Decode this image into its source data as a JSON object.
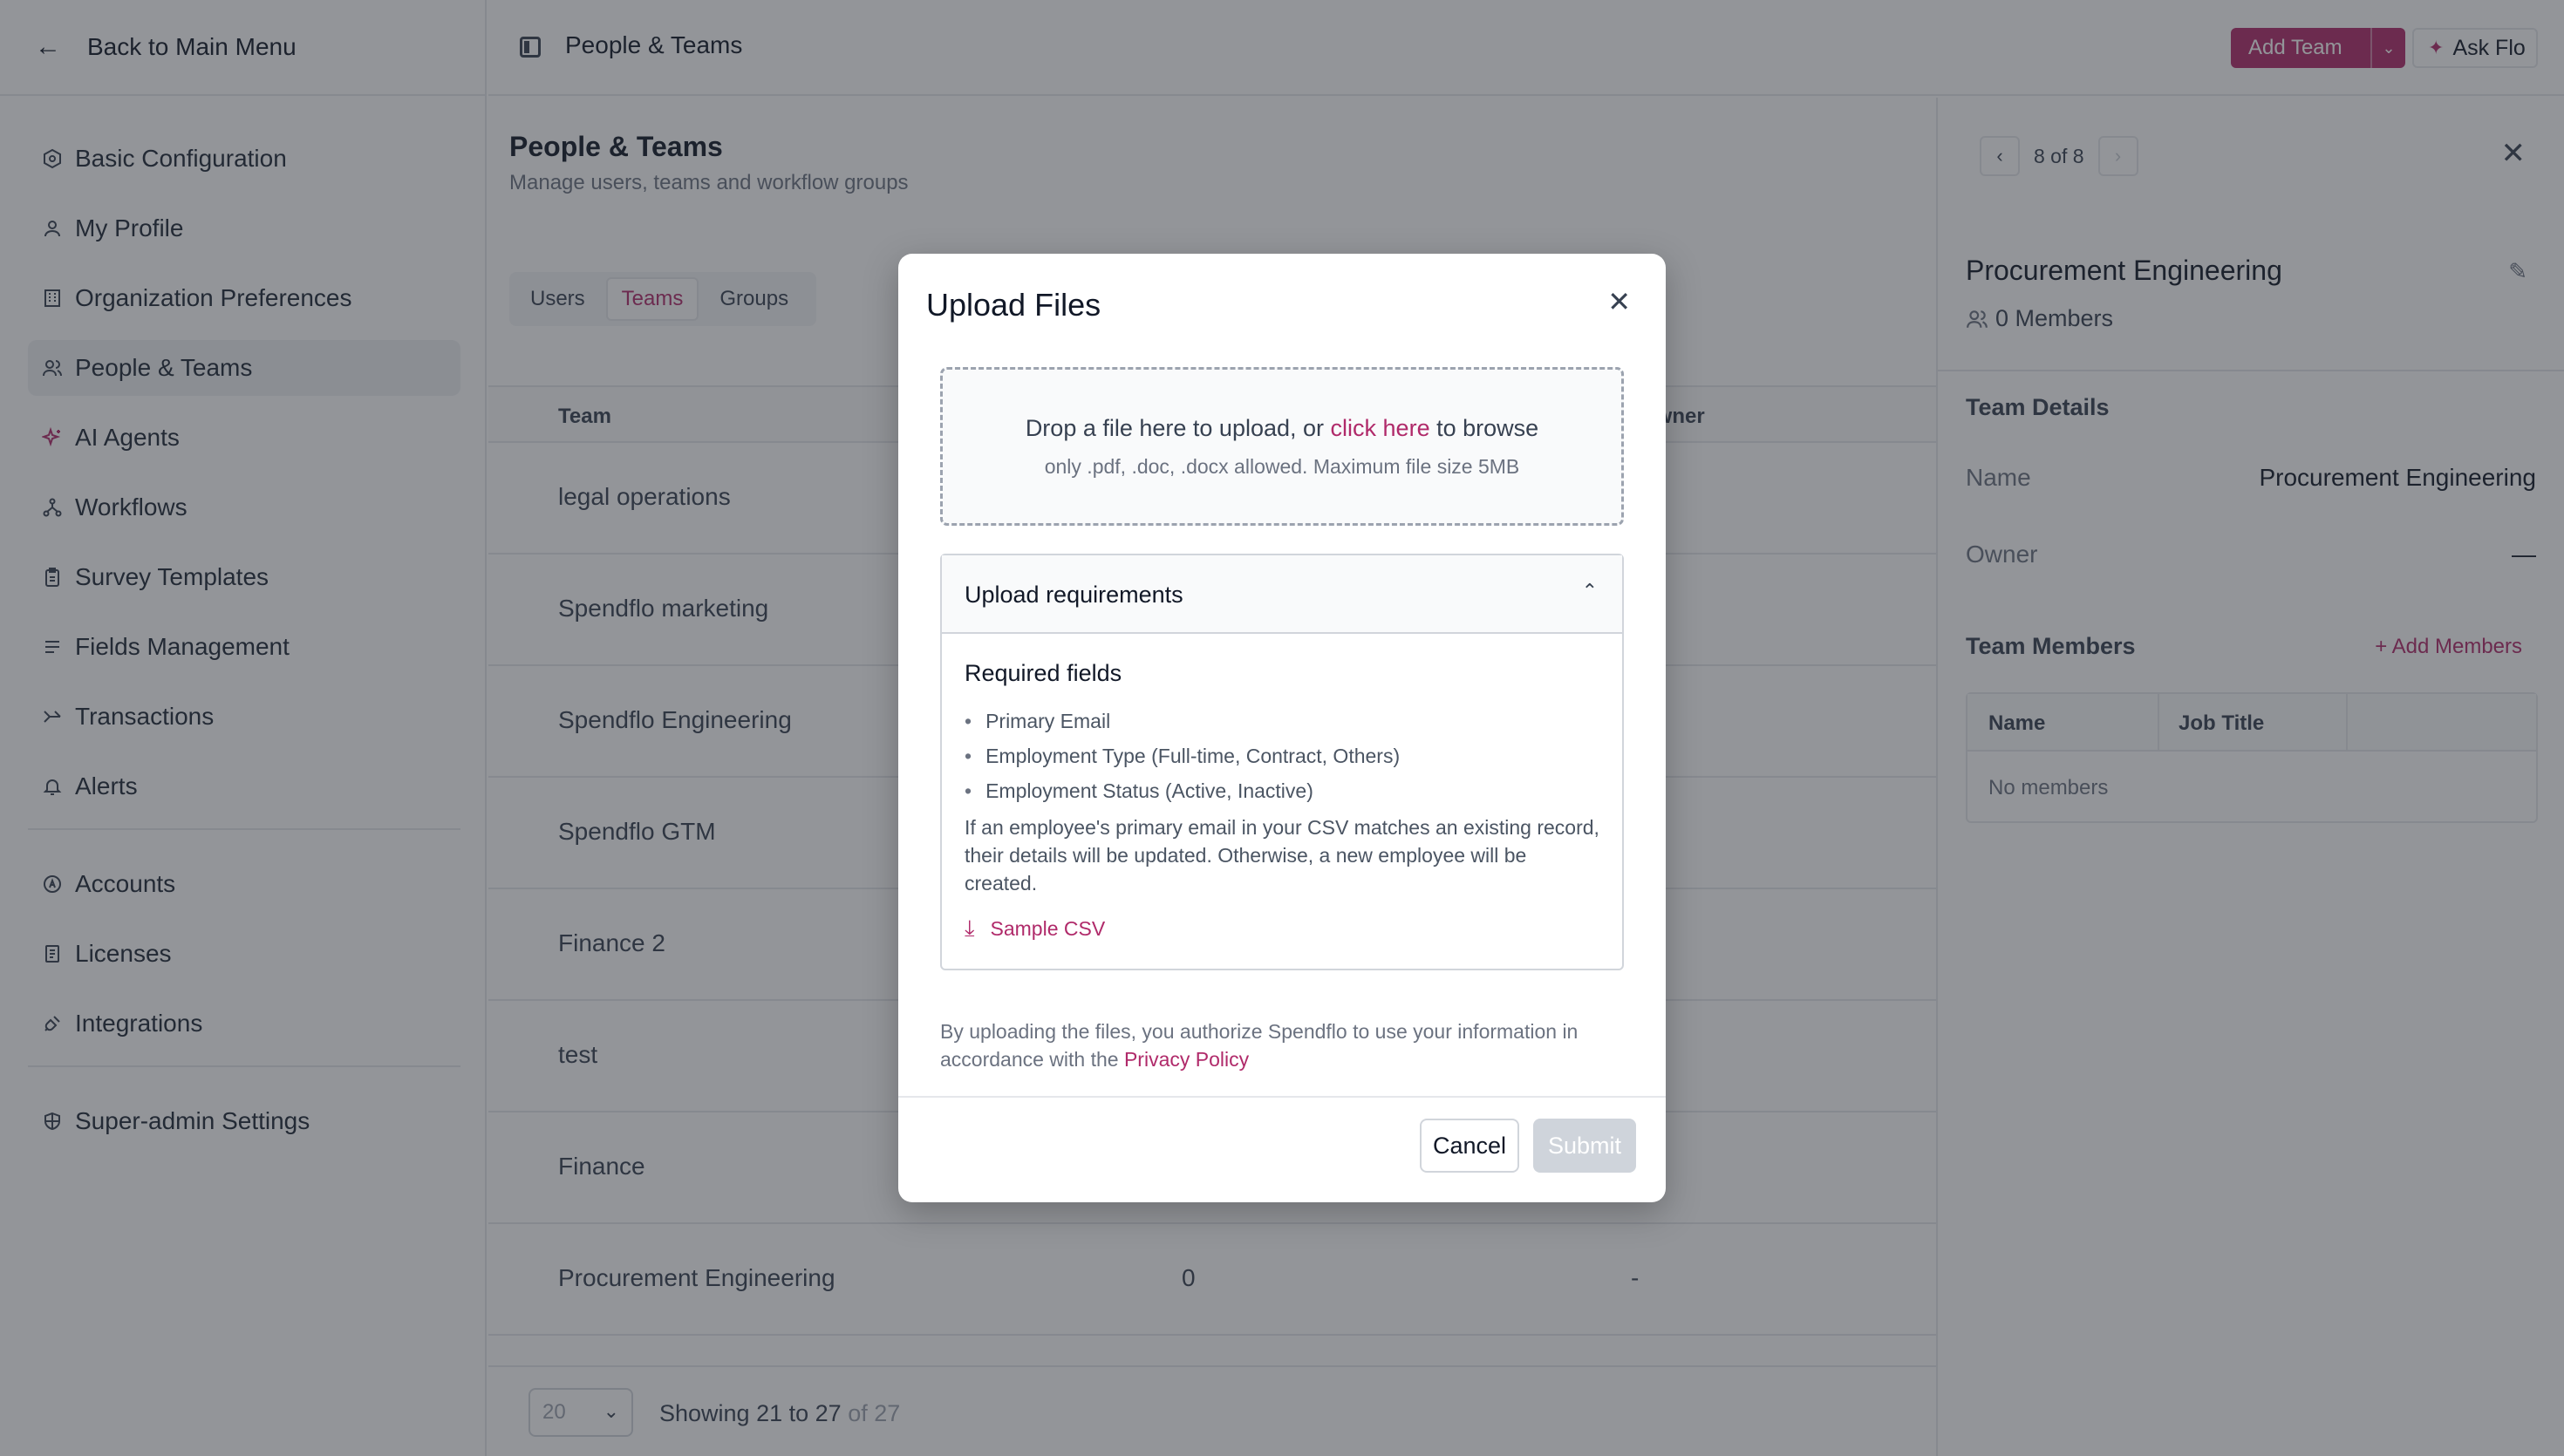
{
  "sidebar": {
    "back_label": "Back to Main Menu",
    "items": [
      {
        "label": "Basic Configuration",
        "icon": "settings-icon"
      },
      {
        "label": "My Profile",
        "icon": "user-icon"
      },
      {
        "label": "Organization Preferences",
        "icon": "building-icon"
      },
      {
        "label": "People & Teams",
        "icon": "users-icon",
        "active": true
      },
      {
        "label": "AI Agents",
        "icon": "sparkle-icon"
      },
      {
        "label": "Workflows",
        "icon": "workflow-icon"
      },
      {
        "label": "Survey Templates",
        "icon": "clipboard-icon"
      },
      {
        "label": "Fields Management",
        "icon": "list-icon"
      },
      {
        "label": "Transactions",
        "icon": "transaction-icon"
      },
      {
        "label": "Alerts",
        "icon": "bell-icon"
      }
    ],
    "items2": [
      {
        "label": "Accounts",
        "icon": "accounts-icon"
      },
      {
        "label": "Licenses",
        "icon": "license-icon"
      },
      {
        "label": "Integrations",
        "icon": "plug-icon"
      }
    ],
    "items3": [
      {
        "label": "Super-admin Settings",
        "icon": "shield-icon"
      }
    ]
  },
  "topbar": {
    "title": "People & Teams",
    "add_team_label": "Add Team",
    "ask_flo_label": "Ask Flo"
  },
  "main": {
    "title": "People & Teams",
    "subtitle": "Manage users, teams and workflow groups",
    "tabs": [
      {
        "label": "Users"
      },
      {
        "label": "Teams",
        "active": true
      },
      {
        "label": "Groups"
      }
    ],
    "columns": {
      "team": "Team",
      "owner_partial": "m Owner"
    },
    "rows": [
      {
        "team": "legal operations",
        "members": "",
        "owner": ""
      },
      {
        "team": "Spendflo marketing",
        "members": "",
        "owner": ""
      },
      {
        "team": "Spendflo Engineering",
        "members": "",
        "owner": ""
      },
      {
        "team": "Spendflo GTM",
        "members": "",
        "owner": ""
      },
      {
        "team": "Finance 2",
        "members": "",
        "owner": ""
      },
      {
        "team": "test",
        "members": "",
        "owner": ""
      },
      {
        "team": "Finance",
        "members": "",
        "owner": ""
      },
      {
        "team": "Procurement Engineering",
        "members": "0",
        "owner": "-"
      }
    ],
    "page_size": "20",
    "showing_prefix": "Showing",
    "showing_range": "21 to 27",
    "showing_total": "of 27"
  },
  "detail": {
    "pager_text": "8 of 8",
    "title": "Procurement Engineering",
    "members_count": "0 Members",
    "team_details_heading": "Team Details",
    "name_label": "Name",
    "name_value": "Procurement Engineering",
    "owner_label": "Owner",
    "owner_value": "—",
    "team_members_heading": "Team Members",
    "add_members_label": "+ Add Members",
    "table_headers": {
      "name": "Name",
      "job_title": "Job Title"
    },
    "empty_text": "No members"
  },
  "modal": {
    "title": "Upload Files",
    "drop_text_before": "Drop a file here to upload, or",
    "drop_link": "click here",
    "drop_text_after": "to browse",
    "drop_hint": "only .pdf, .doc, .docx allowed. Maximum file size 5MB",
    "requirements_heading": "Upload requirements",
    "required_fields_heading": "Required fields",
    "required_fields": [
      "Primary Email",
      "Employment Type (Full-time, Contract, Others)",
      "Employment Status (Active, Inactive)"
    ],
    "note": "If an employee's primary email in your CSV matches an existing record, their details will be updated. Otherwise, a new employee will be created.",
    "sample_csv_label": "Sample CSV",
    "auth_text": "By uploading the files, you authorize Spendflo to use your information in accordance with the",
    "privacy_link": "Privacy Policy",
    "cancel_label": "Cancel",
    "submit_label": "Submit"
  },
  "colors": {
    "accent": "#b02a6a",
    "overlay": "rgba(40,44,52,0.5)",
    "disabled_button": "#cfd4db"
  }
}
